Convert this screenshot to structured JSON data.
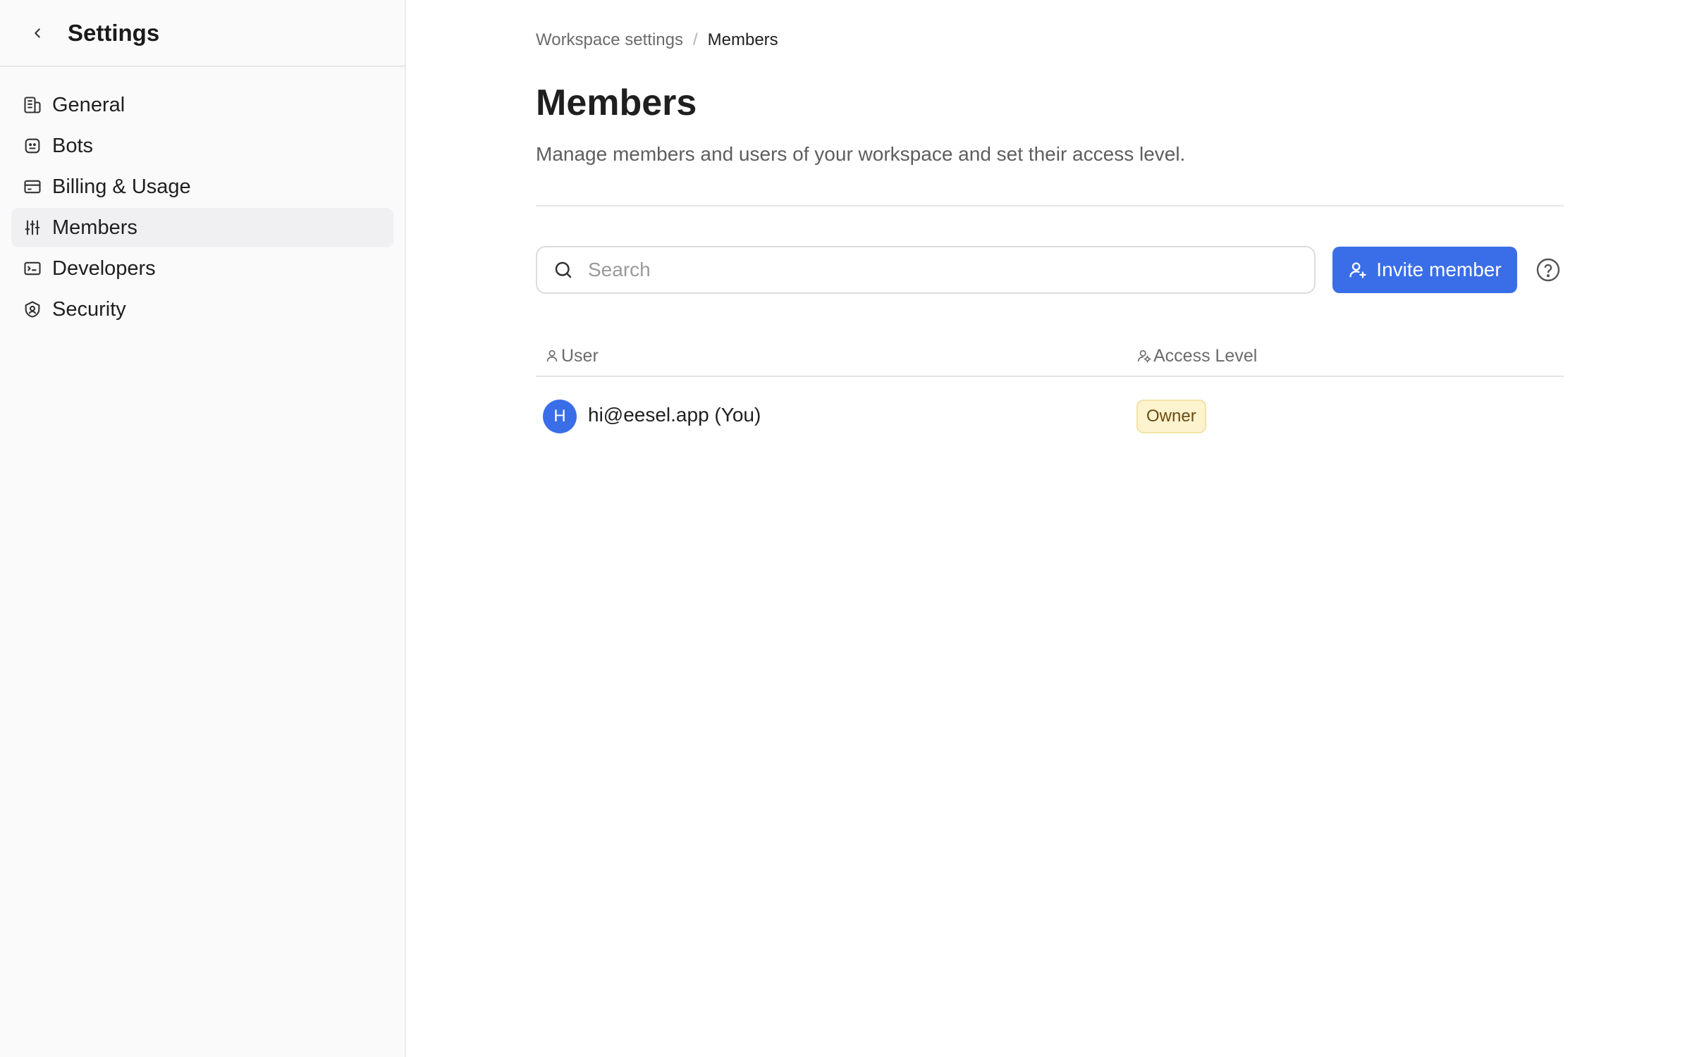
{
  "sidebar": {
    "title": "Settings",
    "items": [
      {
        "label": "General",
        "icon": "building-icon",
        "active": false
      },
      {
        "label": "Bots",
        "icon": "bot-icon",
        "active": false
      },
      {
        "label": "Billing & Usage",
        "icon": "credit-card-icon",
        "active": false
      },
      {
        "label": "Members",
        "icon": "sliders-icon",
        "active": true
      },
      {
        "label": "Developers",
        "icon": "developer-icon",
        "active": false
      },
      {
        "label": "Security",
        "icon": "shield-icon",
        "active": false
      }
    ]
  },
  "breadcrumb": {
    "parent": "Workspace settings",
    "separator": "/",
    "current": "Members"
  },
  "page": {
    "title": "Members",
    "description": "Manage members and users of your workspace and set their access level."
  },
  "toolbar": {
    "search_placeholder": "Search",
    "search_value": "",
    "invite_label": "Invite member"
  },
  "table": {
    "columns": [
      {
        "label": "User",
        "icon": "user-icon"
      },
      {
        "label": "Access Level",
        "icon": "users-key-icon"
      }
    ],
    "rows": [
      {
        "avatar_initial": "H",
        "email": "hi@eesel.app (You)",
        "access": "Owner"
      }
    ]
  },
  "colors": {
    "accent": "#3a6ee8",
    "badge_bg": "#fdf3cf",
    "badge_text": "#6a4a12",
    "sidebar_bg": "#fafafa"
  }
}
